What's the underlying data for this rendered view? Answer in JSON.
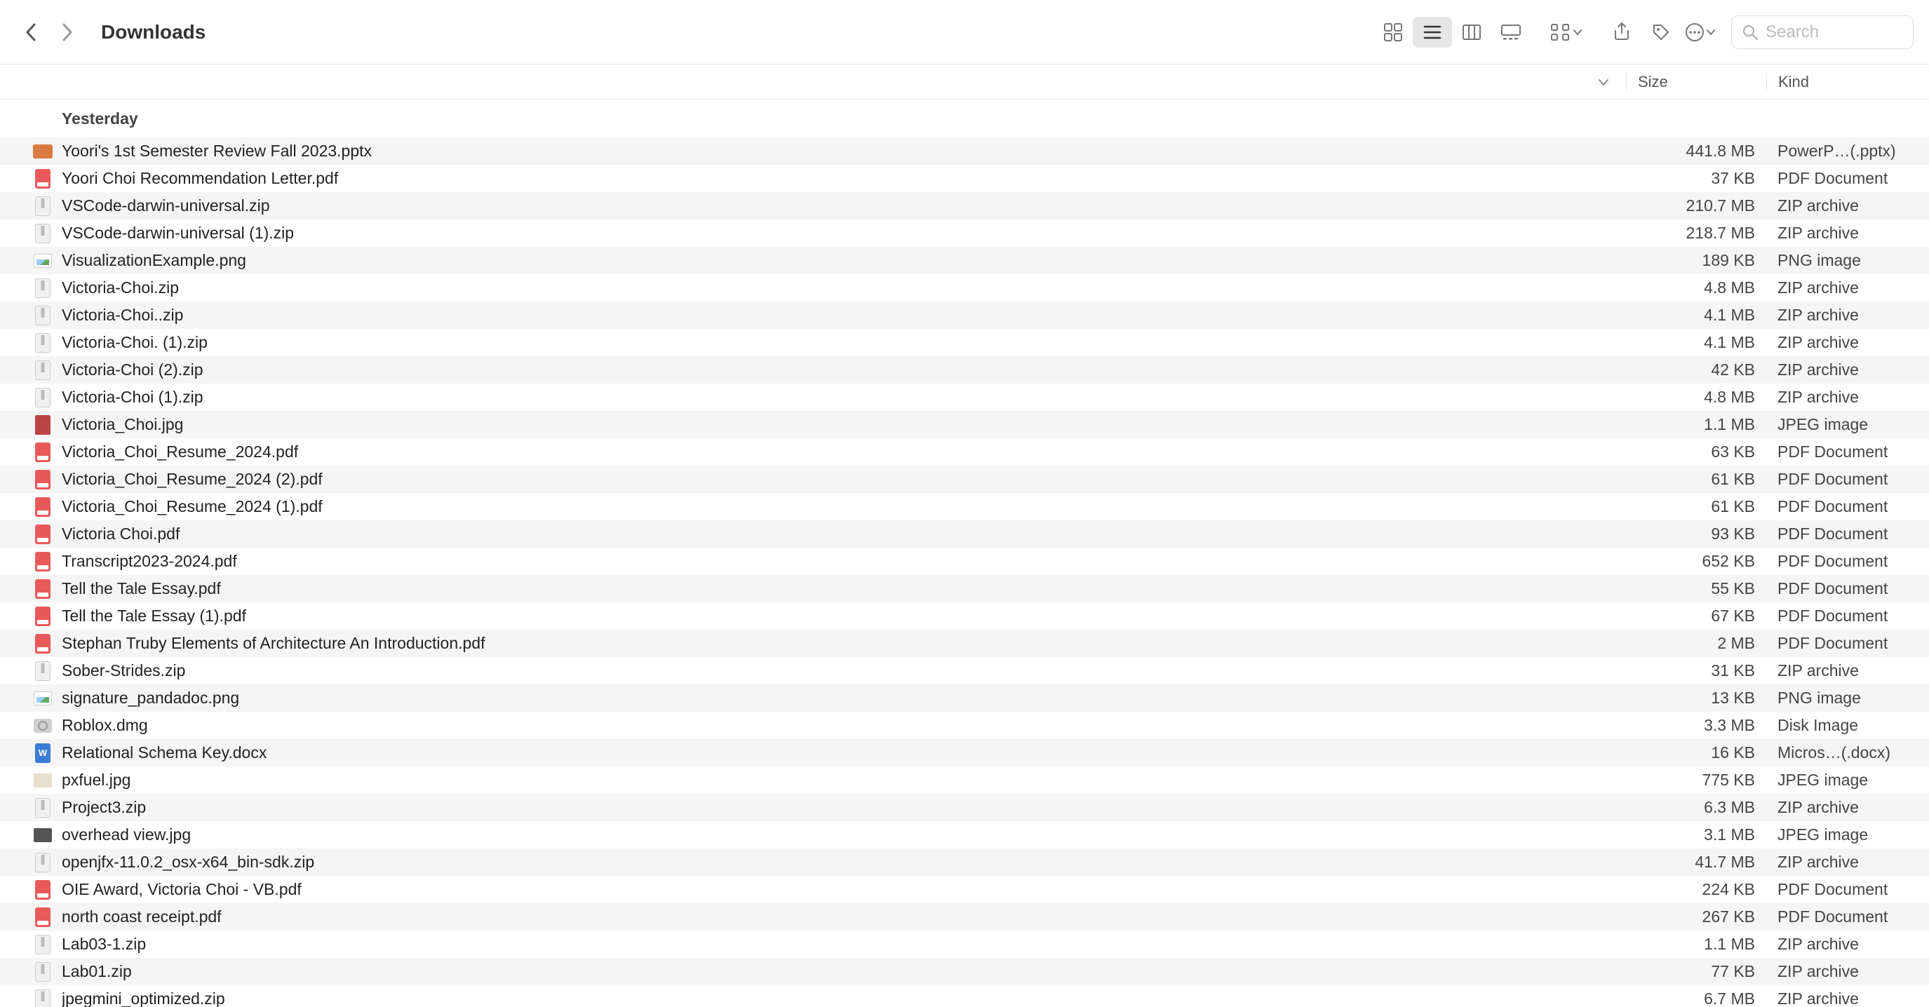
{
  "toolbar": {
    "title": "Downloads",
    "search_placeholder": "Search"
  },
  "columns": {
    "name": "",
    "size": "Size",
    "kind": "Kind"
  },
  "group": "Yesterday",
  "files": [
    {
      "icon": "pptx",
      "name": "Yoori's 1st Semester Review Fall 2023.pptx",
      "size": "441.8 MB",
      "kind": "PowerP…(.pptx)"
    },
    {
      "icon": "pdf",
      "name": "Yoori Choi Recommendation Letter.pdf",
      "size": "37 KB",
      "kind": "PDF Document"
    },
    {
      "icon": "zip",
      "name": "VSCode-darwin-universal.zip",
      "size": "210.7 MB",
      "kind": "ZIP archive"
    },
    {
      "icon": "zip",
      "name": "VSCode-darwin-universal (1).zip",
      "size": "218.7 MB",
      "kind": "ZIP archive"
    },
    {
      "icon": "png",
      "name": "VisualizationExample.png",
      "size": "189 KB",
      "kind": "PNG image"
    },
    {
      "icon": "zip",
      "name": "Victoria-Choi.zip",
      "size": "4.8 MB",
      "kind": "ZIP archive"
    },
    {
      "icon": "zip",
      "name": "Victoria-Choi..zip",
      "size": "4.1 MB",
      "kind": "ZIP archive"
    },
    {
      "icon": "zip",
      "name": "Victoria-Choi. (1).zip",
      "size": "4.1 MB",
      "kind": "ZIP archive"
    },
    {
      "icon": "zip",
      "name": "Victoria-Choi (2).zip",
      "size": "42 KB",
      "kind": "ZIP archive"
    },
    {
      "icon": "zip",
      "name": "Victoria-Choi (1).zip",
      "size": "4.8 MB",
      "kind": "ZIP archive"
    },
    {
      "icon": "jpg",
      "name": "Victoria_Choi.jpg",
      "size": "1.1 MB",
      "kind": "JPEG image"
    },
    {
      "icon": "pdf",
      "name": "Victoria_Choi_Resume_2024.pdf",
      "size": "63 KB",
      "kind": "PDF Document"
    },
    {
      "icon": "pdf",
      "name": "Victoria_Choi_Resume_2024 (2).pdf",
      "size": "61 KB",
      "kind": "PDF Document"
    },
    {
      "icon": "pdf",
      "name": "Victoria_Choi_Resume_2024 (1).pdf",
      "size": "61 KB",
      "kind": "PDF Document"
    },
    {
      "icon": "pdf",
      "name": "Victoria Choi.pdf",
      "size": "93 KB",
      "kind": "PDF Document"
    },
    {
      "icon": "pdf",
      "name": "Transcript2023-2024.pdf",
      "size": "652 KB",
      "kind": "PDF Document"
    },
    {
      "icon": "pdf",
      "name": "Tell the Tale Essay.pdf",
      "size": "55 KB",
      "kind": "PDF Document"
    },
    {
      "icon": "pdf",
      "name": "Tell the Tale Essay (1).pdf",
      "size": "67 KB",
      "kind": "PDF Document"
    },
    {
      "icon": "pdf",
      "name": "Stephan Truby Elements of Architecture An Introduction.pdf",
      "size": "2 MB",
      "kind": "PDF Document"
    },
    {
      "icon": "zip",
      "name": "Sober-Strides.zip",
      "size": "31 KB",
      "kind": "ZIP archive"
    },
    {
      "icon": "png",
      "name": "signature_pandadoc.png",
      "size": "13 KB",
      "kind": "PNG image"
    },
    {
      "icon": "dmg",
      "name": "Roblox.dmg",
      "size": "3.3 MB",
      "kind": "Disk Image"
    },
    {
      "icon": "docx",
      "name": "Relational Schema Key.docx",
      "size": "16 KB",
      "kind": "Micros…(.docx)"
    },
    {
      "icon": "img2",
      "name": "pxfuel.jpg",
      "size": "775 KB",
      "kind": "JPEG image"
    },
    {
      "icon": "zip",
      "name": "Project3.zip",
      "size": "6.3 MB",
      "kind": "ZIP archive"
    },
    {
      "icon": "img",
      "name": "overhead view.jpg",
      "size": "3.1 MB",
      "kind": "JPEG image"
    },
    {
      "icon": "zip",
      "name": "openjfx-11.0.2_osx-x64_bin-sdk.zip",
      "size": "41.7 MB",
      "kind": "ZIP archive"
    },
    {
      "icon": "pdf",
      "name": "OIE Award, Victoria Choi - VB.pdf",
      "size": "224 KB",
      "kind": "PDF Document"
    },
    {
      "icon": "pdf",
      "name": "north coast receipt.pdf",
      "size": "267 KB",
      "kind": "PDF Document"
    },
    {
      "icon": "zip",
      "name": "Lab03-1.zip",
      "size": "1.1 MB",
      "kind": "ZIP archive"
    },
    {
      "icon": "zip",
      "name": "Lab01.zip",
      "size": "77 KB",
      "kind": "ZIP archive"
    },
    {
      "icon": "zip",
      "name": "jpegmini_optimized.zip",
      "size": "6.7 MB",
      "kind": "ZIP archive"
    }
  ]
}
